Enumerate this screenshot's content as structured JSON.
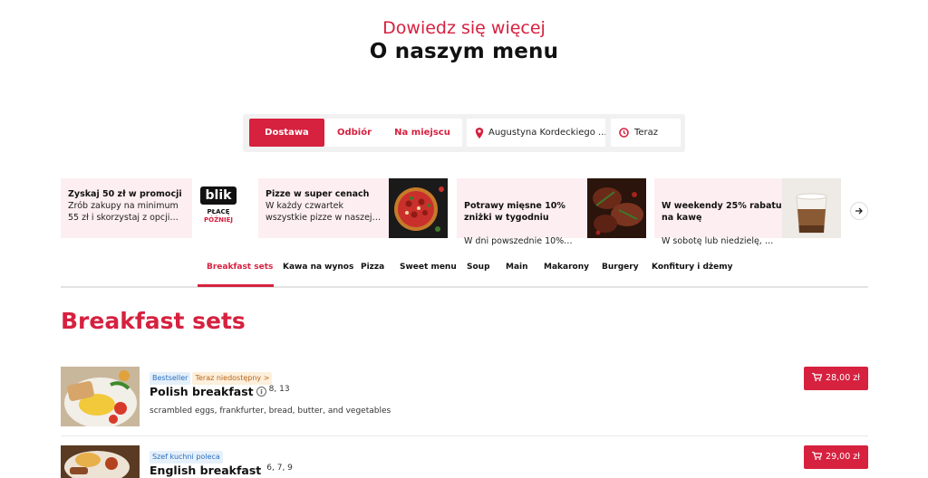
{
  "header": {
    "eyebrow": "Dowiedz się więcej",
    "title": "O naszym menu"
  },
  "order_bar": {
    "modes": [
      "Dostawa",
      "Odbiór",
      "Na miejscu"
    ],
    "active_mode": "Dostawa",
    "address": "Augustyna Kordeckiego ...",
    "time": "Teraz"
  },
  "promos": [
    {
      "title": "Zyskaj 50 zł w promocji",
      "desc": "Zrób zakupy na minimum\n55 zł i skorzystaj z opcji…",
      "image": "blik-logo",
      "image_text": [
        "blik",
        "PŁACĘ",
        "PÓŹNIEJ"
      ]
    },
    {
      "title": "Pizze w super cenach",
      "desc": "W każdy czwartek\nwszystkie pizze w naszej…",
      "image": "pizza-photo"
    },
    {
      "title": "Potrawy mięsne 10%\nzniżki w tygodniu",
      "desc": "W dni powszednie 10%…",
      "image": "meat-photo"
    },
    {
      "title": "W weekendy 25% rabatu\nna kawę",
      "desc": "W sobotę lub niedzielę, …",
      "image": "coffee-photo"
    }
  ],
  "categories": [
    "Breakfast sets",
    "Kawa na wynos",
    "Pizza",
    "Sweet menu",
    "Soup",
    "Main",
    "Makarony",
    "Burgery",
    "Konfitury i dżemy"
  ],
  "active_category": "Breakfast sets",
  "section_title": "Breakfast sets",
  "dishes": [
    {
      "badges": [
        "Bestseller",
        "Teraz niedostępny >"
      ],
      "name": "Polish breakfast",
      "allergens": "8, 13",
      "description": "scrambled eggs, frankfurter, bread, butter, and vegetables",
      "price": "28,00 zł"
    },
    {
      "badges": [
        "Szef kuchni poleca"
      ],
      "name": "English breakfast",
      "allergens": "6, 7, 9",
      "description": "",
      "price": "29,00 zł"
    }
  ],
  "colors": {
    "accent": "#d6213f",
    "promo_bg": "#fdeef1"
  },
  "icons": [
    "location-pin-icon",
    "clock-icon",
    "arrow-right-icon",
    "cart-icon",
    "info-icon"
  ]
}
